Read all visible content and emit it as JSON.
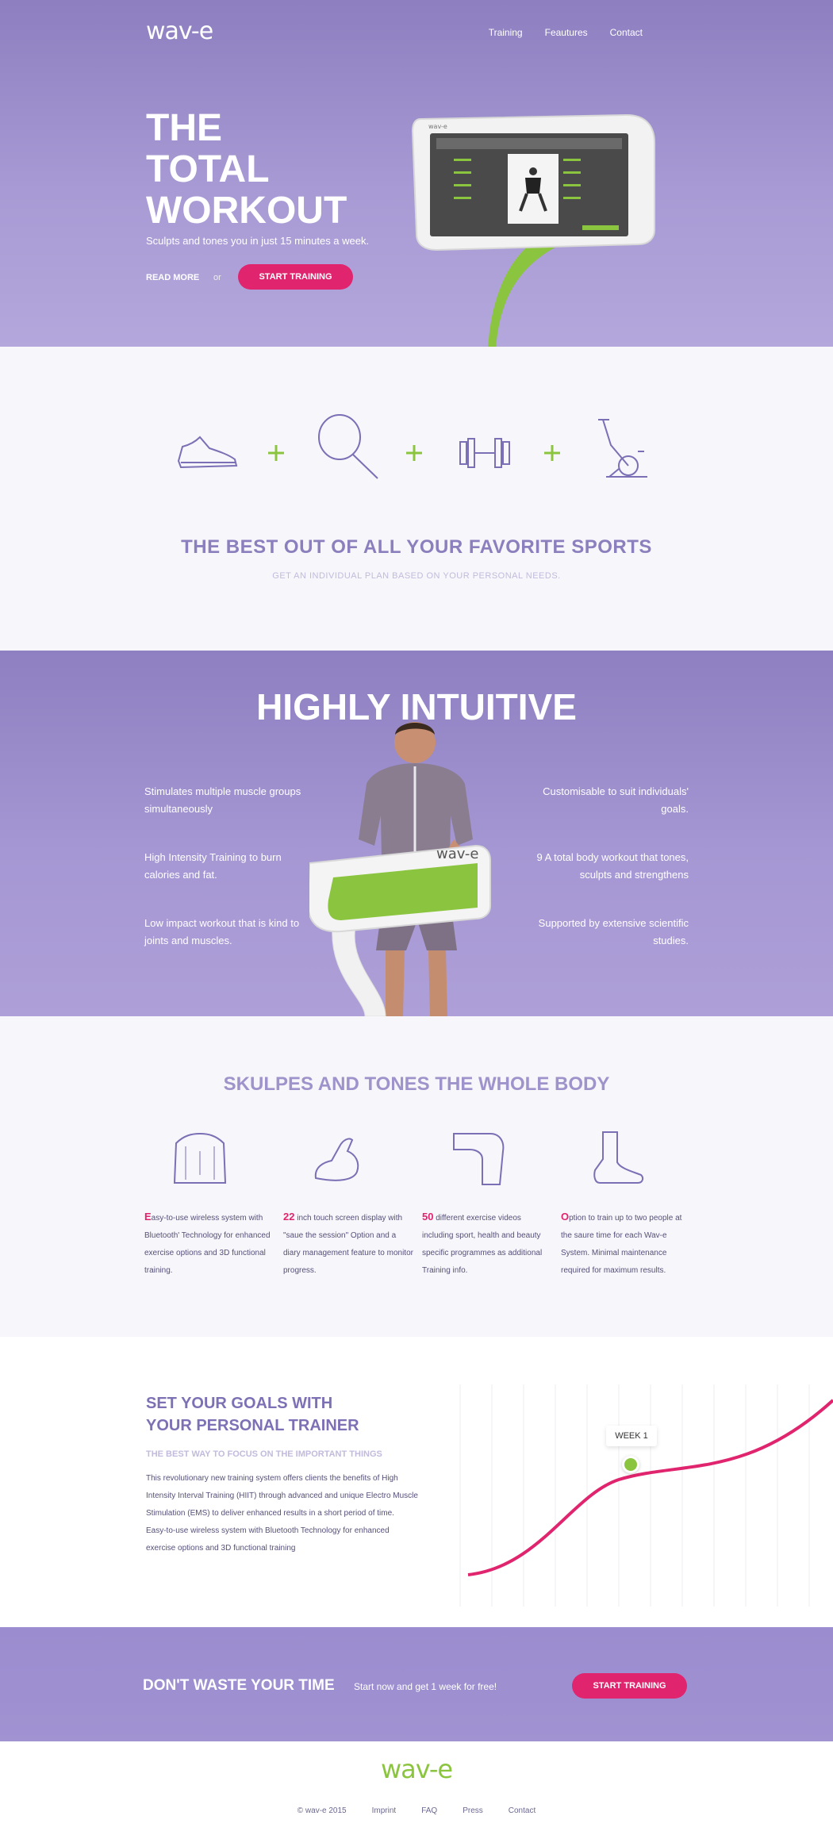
{
  "brand": {
    "logo": "wav-e",
    "accent_purple": "#8d7fc0",
    "accent_pink": "#e0246e",
    "accent_green": "#8bc53f"
  },
  "nav": {
    "items": [
      "Training",
      "Feautures",
      "Contact"
    ]
  },
  "hero": {
    "title_lines": [
      "THE",
      "TOTAL",
      "WORKOUT"
    ],
    "subtitle": "Sculpts and tones you in just 15 minutes a week.",
    "read_more": "READ MORE",
    "or": "or",
    "cta": "START TRAINING"
  },
  "sports": {
    "icons": [
      "sneaker-icon",
      "tennis-racket-icon",
      "dumbbell-icon",
      "exercise-bike-icon"
    ],
    "title": "THE BEST OUT OF ALL YOUR FAVORITE SPORTS",
    "subtitle": "GET AN INDIVIDUAL PLAN BASED ON YOUR PERSONAL NEEDS."
  },
  "intuitive": {
    "title": "HIGHLY INTUITIVE",
    "left": [
      "Stimulates multiple muscle groups simultaneously",
      "High Intensity Training to burn calories and fat.",
      "Low impact workout that is kind to joints and muscles."
    ],
    "right": [
      "Customisable to suit individuals' goals.",
      "9 A total body workout that tones, sculpts and strengthens",
      "Supported by extensive scientific studies."
    ]
  },
  "body": {
    "title": "SKULPES AND TONES THE WHOLE BODY",
    "icons": [
      "torso-icon",
      "bicep-icon",
      "thigh-icon",
      "foot-icon"
    ],
    "items": [
      {
        "em": "E",
        "text": "asy-to-use wireless system with Bluetooth' Technology for enhanced exercise options and 3D functional training."
      },
      {
        "em": "22",
        "text": " inch touch screen display with \"saue the session\" Option and a diary management feature to monitor progress."
      },
      {
        "em": "50",
        "text": " different exercise videos including sport, health and beauty specific programmes as additional Training info."
      },
      {
        "em": "O",
        "text": "ption to train up to two people at the saure time for each Wav-e System. Minimal maintenance required for maximum results."
      }
    ]
  },
  "goals": {
    "title_line1": "SET YOUR GOALS WITH",
    "title_line2": "YOUR PERSONAL TRAINER",
    "kicker": "THE BEST WAY TO FOCUS ON THE IMPORTANT THINGS",
    "body": "This revolutionary new training system offers clients the benefits of High Intensity Interval Training (HIIT) through advanced and unique Electro Muscle Stimulation (EMS) to deliver enhanced results in a short period of time.",
    "body2": "Easy-to-use wireless system with Bluetooth Technology for enhanced exercise options and 3D functional training",
    "week": "WEEK 1"
  },
  "cta": {
    "title": "DON'T WASTE YOUR TIME",
    "subtitle": "Start now and get 1 week for free!",
    "button": "START TRAINING"
  },
  "footer": {
    "logo": "wav-e",
    "copyright": "©  wav-e 2015",
    "links": [
      "Imprint",
      "FAQ",
      "Press",
      "Contact"
    ]
  }
}
